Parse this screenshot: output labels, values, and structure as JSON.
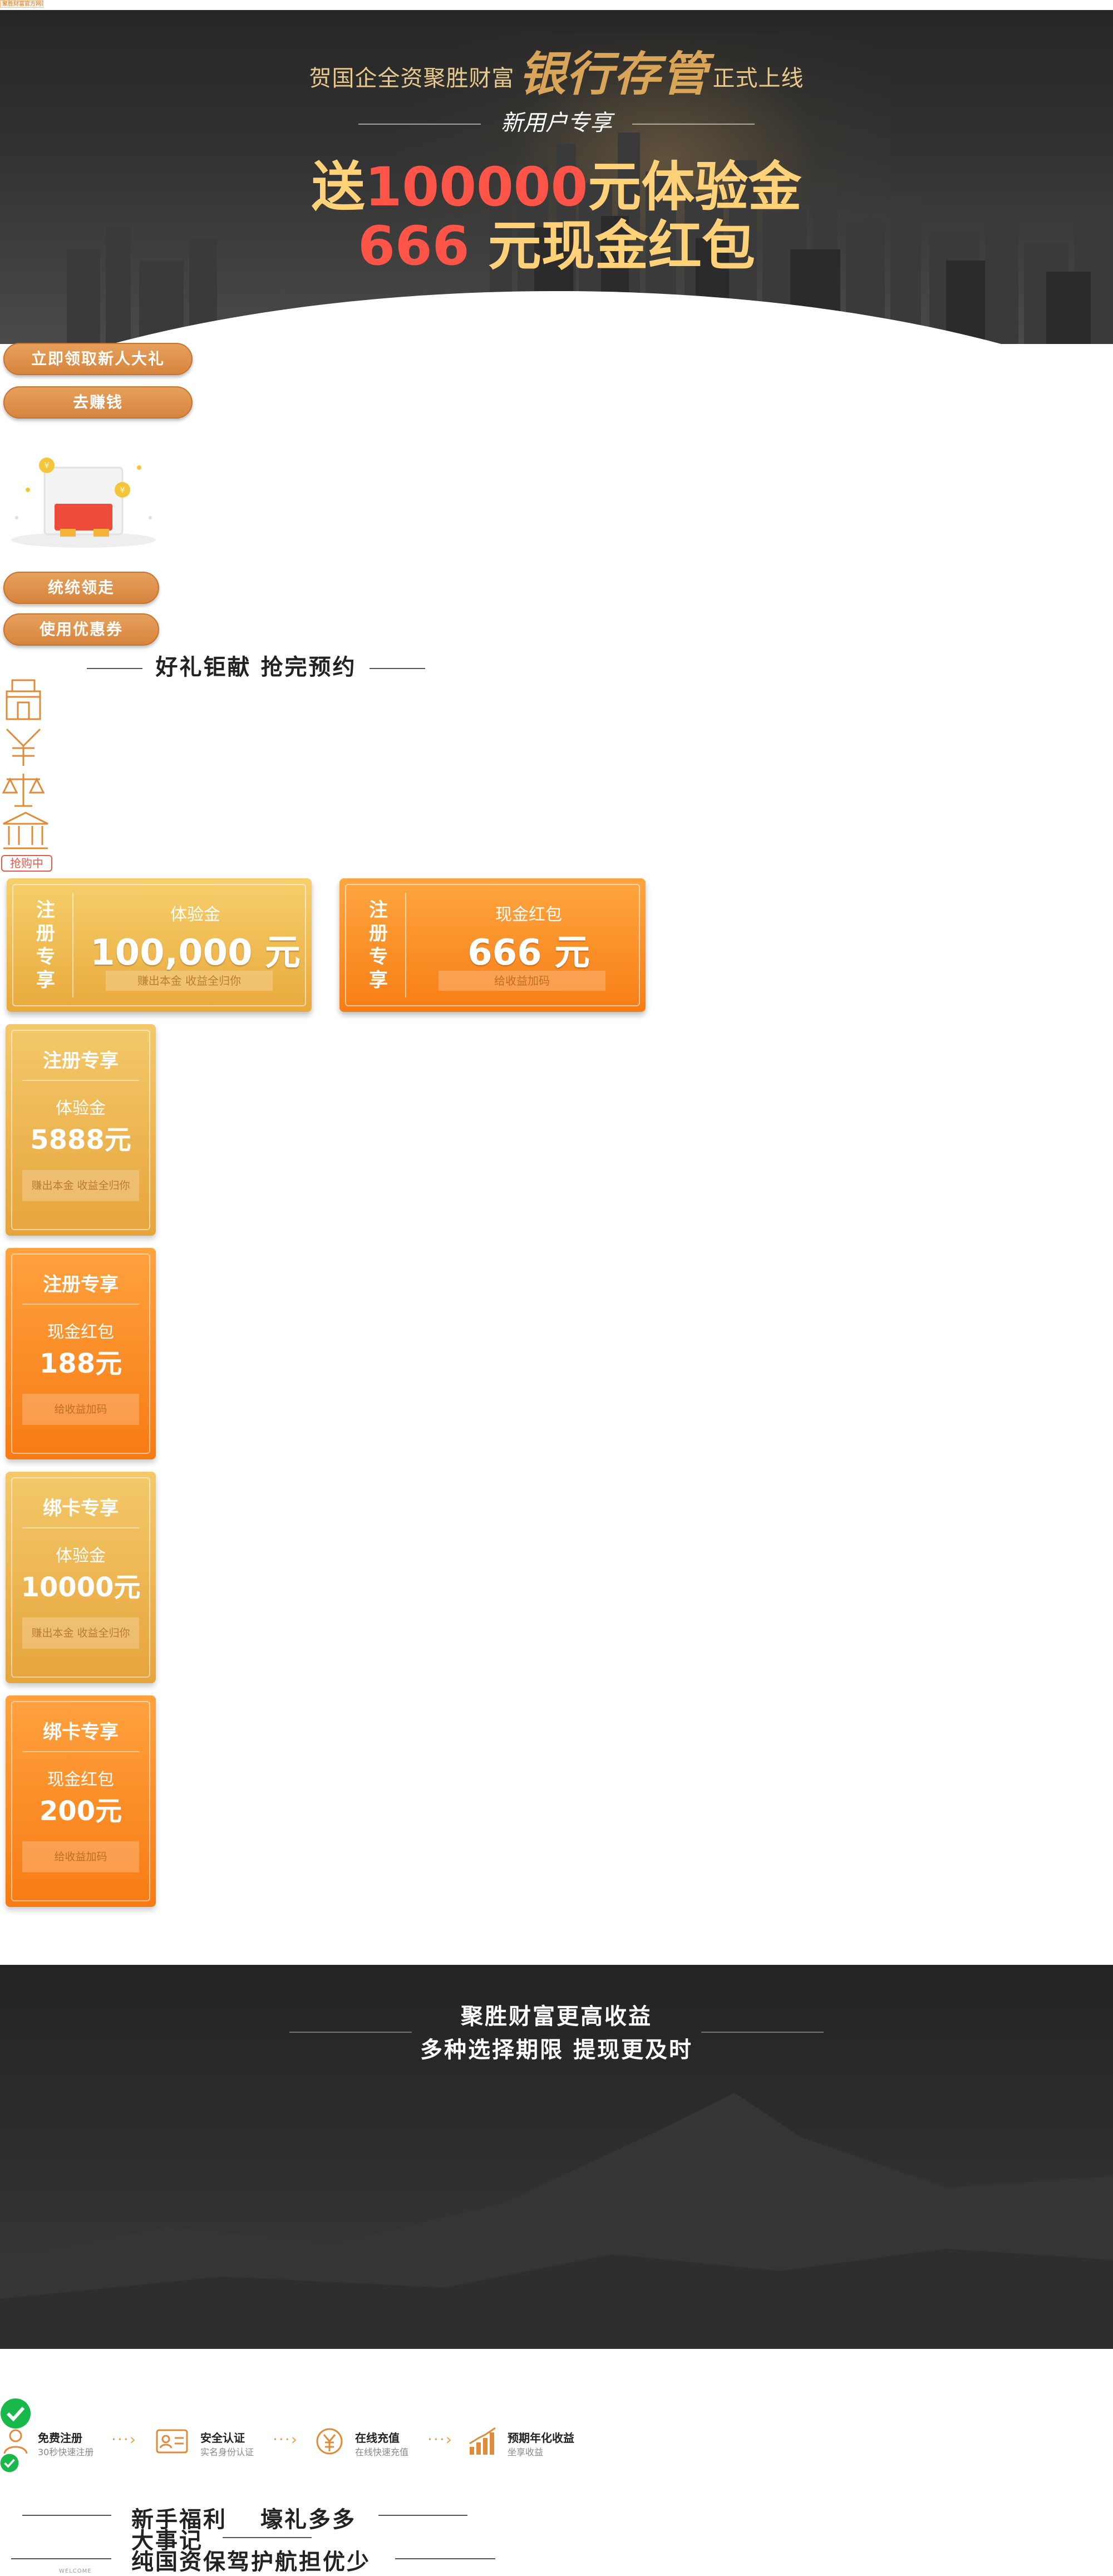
{
  "top_tag": "聚胜财富官方网站",
  "hero": {
    "line1_pre": "贺国企全资聚胜财富",
    "line1_big": "银行存管",
    "line1_post": "正式上线",
    "line2": "新用户专享",
    "line3_pre": "送",
    "line3_num": "100000",
    "line3_post": "元体验金",
    "line4_num": "666",
    "line4_post": "元现金红包"
  },
  "buttons": {
    "claim_gift": "立即领取新人大礼",
    "earn": "去赚钱",
    "take_all": "统统领走",
    "use_coupon": "使用优惠券"
  },
  "section1": {
    "title": "好礼钜献 抢完预约"
  },
  "icons": [
    "tower-icon",
    "yuan-coin-icon",
    "scale-icon",
    "bank-icon"
  ],
  "badge": "抢购中",
  "wide_cards": [
    {
      "tag": "注册专享",
      "label": "体验金",
      "amount": "100,000 元",
      "note": "赚出本金 收益全归你"
    },
    {
      "tag": "注册专享",
      "label": "现金红包",
      "amount": "666 元",
      "note": "给收益加码"
    }
  ],
  "narrow_cards": [
    {
      "head": "注册专享",
      "label": "体验金",
      "amount": "5888元",
      "note": "赚出本金 收益全归你"
    },
    {
      "head": "注册专享",
      "label": "现金红包",
      "amount": "188元",
      "note": "给收益加码"
    },
    {
      "head": "绑卡专享",
      "label": "体验金",
      "amount": "10000元",
      "note": "赚出本金 收益全归你"
    },
    {
      "head": "绑卡专享",
      "label": "现金红包",
      "amount": "200元",
      "note": "给收益加码"
    }
  ],
  "dark_section": {
    "line1": "聚胜财富更高收益",
    "line2": "多种选择期限 提现更及时"
  },
  "steps": [
    {
      "title": "免费注册",
      "sub": "30秒快速注册",
      "icon": "user-icon"
    },
    {
      "title": "安全认证",
      "sub": "实名身份认证",
      "icon": "id-card-icon"
    },
    {
      "title": "在线充值",
      "sub": "在线快速充值",
      "icon": "yuan-recharge-icon"
    },
    {
      "title": "预期年化收益",
      "sub": "坐享收益",
      "icon": "chart-icon"
    }
  ],
  "bottom": {
    "title1_a": "新手福利",
    "title1_b": "壕礼多多",
    "title2": "大事记",
    "title3": "纯国资保驾护航担优少",
    "welcome": "WELCOME"
  },
  "colors": {
    "accent_orange": "#d7843c",
    "gold": "#ffd178",
    "red": "#ff5548",
    "dark_bg": "#2d2d2d"
  }
}
